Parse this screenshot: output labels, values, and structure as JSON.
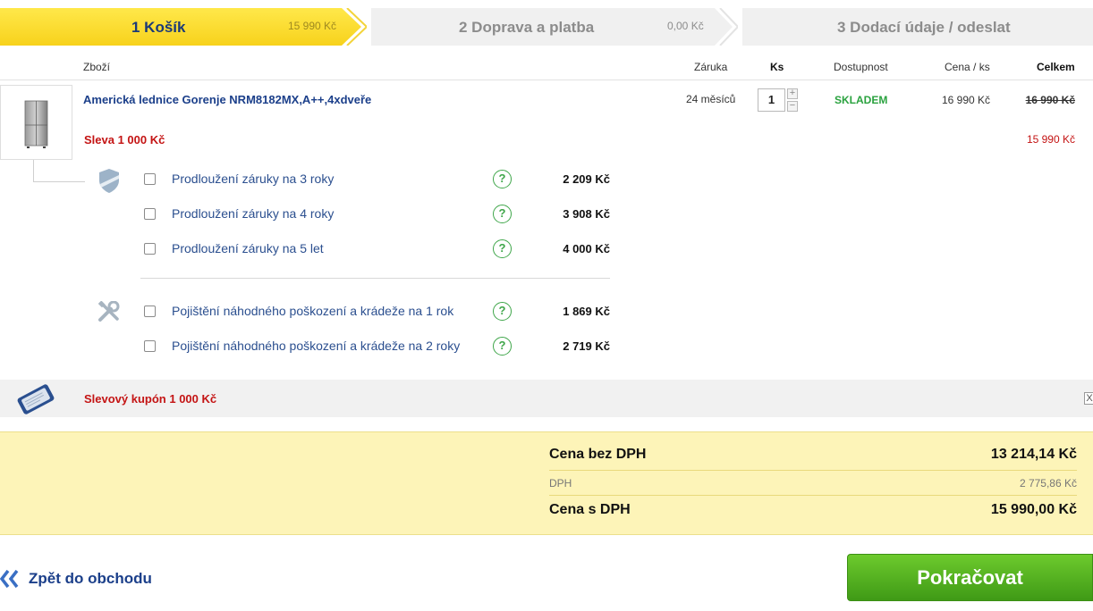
{
  "steps": [
    {
      "label": "1 Košík",
      "price": "15 990 Kč"
    },
    {
      "label": "2 Doprava a platba",
      "price": "0,00 Kč"
    },
    {
      "label": "3 Dodací údaje / odeslat"
    }
  ],
  "table_header": {
    "product": "Zboží",
    "warranty": "Záruka",
    "qty": "Ks",
    "availability": "Dostupnost",
    "unit_price": "Cena / ks",
    "total": "Celkem"
  },
  "product": {
    "name": "Americká lednice Gorenje NRM8182MX,A++,4xdveře",
    "warranty": "24 měsíců",
    "quantity": "1",
    "qty_plus": "+",
    "qty_minus": "−",
    "availability": "SKLADEM",
    "unit_price": "16 990 Kč",
    "old_total": "16 990 Kč",
    "discount_label": "Sleva 1 000 Kč",
    "new_total": "15 990 Kč"
  },
  "services": {
    "help_symbol": "?",
    "warranty_icon": "shield-icon",
    "insurance_icon": "tools-icon",
    "warranty_options": [
      {
        "label": "Prodloužení záruky na 3 roky",
        "price": "2 209 Kč"
      },
      {
        "label": "Prodloužení záruky na 4 roky",
        "price": "3 908 Kč"
      },
      {
        "label": "Prodloužení záruky na 5 let",
        "price": "4 000 Kč"
      }
    ],
    "insurance_options": [
      {
        "label": "Pojištění náhodného poškození a krádeže na 1 rok",
        "price": "1 869 Kč"
      },
      {
        "label": "Pojištění náhodného poškození a krádeže na 2 roky",
        "price": "2 719 Kč"
      }
    ]
  },
  "coupon": {
    "text": "Slevový kupón 1 000 Kč",
    "close": "X"
  },
  "summary": {
    "without_vat_label": "Cena bez DPH",
    "without_vat_value": "13 214,14 Kč",
    "vat_label": "DPH",
    "vat_value": "2 775,86 Kč",
    "with_vat_label": "Cena s DPH",
    "with_vat_value": "15 990,00 Kč"
  },
  "footer": {
    "back_label": "Zpět do obchodu",
    "continue_label": "Pokračovat"
  },
  "colors": {
    "active_step": "#ffe033",
    "inactive_step": "#f0f0f0",
    "accent_blue": "#1b3f8a",
    "discount_red": "#c41414",
    "stock_green": "#2aa23f",
    "summary_bg": "#fdf4b8",
    "continue_green": "#52b11f"
  }
}
